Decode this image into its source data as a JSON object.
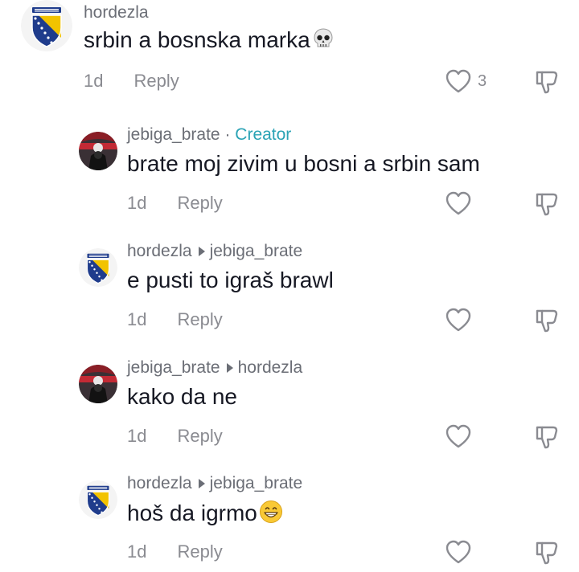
{
  "comments": [
    {
      "username": "hordezla",
      "text": "srbin a bosnska marka",
      "emoji": "skull-emoji",
      "age": "1d",
      "reply_label": "Reply",
      "like_count": "3"
    },
    {
      "username": "jebiga_brate",
      "separator": "·",
      "badge": "Creator",
      "text": "brate moj zivim u bosni a srbin sam",
      "age": "1d",
      "reply_label": "Reply"
    },
    {
      "username": "hordezla",
      "reply_to": "jebiga_brate",
      "text": "e pusti to igraš brawl",
      "age": "1d",
      "reply_label": "Reply"
    },
    {
      "username": "jebiga_brate",
      "reply_to": "hordezla",
      "text": "kako da ne",
      "age": "1d",
      "reply_label": "Reply"
    },
    {
      "username": "hordezla",
      "reply_to": "jebiga_brate",
      "text": "hoš da igrmo",
      "emoji": "grinning-emoji",
      "age": "1d",
      "reply_label": "Reply"
    }
  ],
  "colors": {
    "creator_badge": "#2aa3b5",
    "muted_text": "#8a8b91",
    "primary_text": "#161823"
  }
}
